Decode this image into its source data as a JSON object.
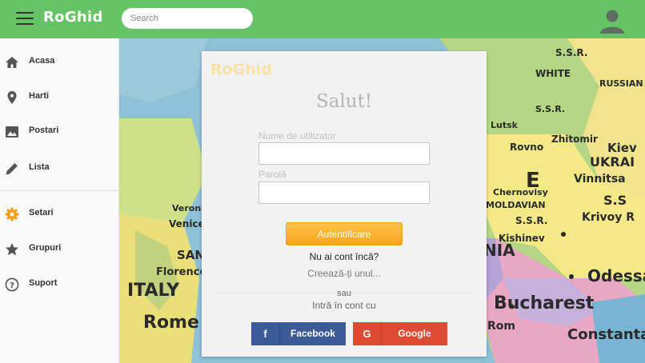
{
  "topbar": {
    "brand": "RoGhid",
    "search_placeholder": "Search",
    "color": "#66c466"
  },
  "sidebar": {
    "items": [
      {
        "label": "Acasa",
        "icon": "home-icon"
      },
      {
        "label": "Harti",
        "icon": "map-pin-icon"
      },
      {
        "label": "Postari",
        "icon": "image-icon"
      },
      {
        "label": "Lista",
        "icon": "pencil-icon"
      },
      {
        "label": "Setari",
        "icon": "gear-icon",
        "color": "#f39c12"
      },
      {
        "label": "Grupuri",
        "icon": "star-icon"
      },
      {
        "label": "Suport",
        "icon": "help-icon"
      }
    ]
  },
  "map": {
    "labels": [
      "S.S.R.",
      "WHITE",
      "RUSSIAN",
      "S.S.R.",
      "Lutsk",
      "Zhitomir",
      "Kiev",
      "Rovno",
      "UKRAI",
      "E",
      "Vinnitsa",
      "Chernovisy",
      "S.S",
      "MOLDAVIAN",
      "S.S.R.",
      "Krivoy R",
      "Kishinev",
      "NIA",
      "Odessa",
      "Bucharest",
      "Rom",
      "Constanta",
      "Verona",
      "Venice",
      "SAN",
      "ITALY",
      "Florence",
      "Rome"
    ]
  },
  "login": {
    "logo": "RoGhid",
    "title": "Salut!",
    "username_label": "Nume de utilizator",
    "password_label": "Parolă",
    "submit_label": "Autentificare",
    "no_account_text": "Nu ai cont încă?",
    "create_link": "Creează-ți unul...",
    "or_text": "sau",
    "enter_with_text": "Intră  în cont cu",
    "facebook_label": "Facebook",
    "facebook_icon": "f",
    "google_label": "Google",
    "google_icon": "G",
    "facebook_color": "#3b5a98",
    "google_color": "#df4a33",
    "button_color": "#f9a41c"
  }
}
